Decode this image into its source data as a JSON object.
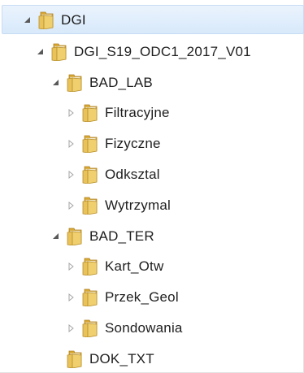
{
  "tree": {
    "nodes": [
      {
        "label": "DGI",
        "depth": 0,
        "state": "expanded",
        "selected": true,
        "icon": "folder-icon"
      },
      {
        "label": "DGI_S19_ODC1_2017_V01",
        "depth": 1,
        "state": "expanded",
        "selected": false,
        "icon": "folder-icon"
      },
      {
        "label": "BAD_LAB",
        "depth": 2,
        "state": "expanded",
        "selected": false,
        "icon": "folder-icon"
      },
      {
        "label": "Filtracyjne",
        "depth": 3,
        "state": "collapsed",
        "selected": false,
        "icon": "folder-icon"
      },
      {
        "label": "Fizyczne",
        "depth": 3,
        "state": "collapsed",
        "selected": false,
        "icon": "folder-icon"
      },
      {
        "label": "Odksztal",
        "depth": 3,
        "state": "collapsed",
        "selected": false,
        "icon": "folder-icon"
      },
      {
        "label": "Wytrzymal",
        "depth": 3,
        "state": "collapsed",
        "selected": false,
        "icon": "folder-icon"
      },
      {
        "label": "BAD_TER",
        "depth": 2,
        "state": "expanded",
        "selected": false,
        "icon": "folder-icon"
      },
      {
        "label": "Kart_Otw",
        "depth": 3,
        "state": "collapsed",
        "selected": false,
        "icon": "folder-icon"
      },
      {
        "label": "Przek_Geol",
        "depth": 3,
        "state": "collapsed",
        "selected": false,
        "icon": "folder-icon"
      },
      {
        "label": "Sondowania",
        "depth": 3,
        "state": "collapsed",
        "selected": false,
        "icon": "folder-icon"
      },
      {
        "label": "DOK_TXT",
        "depth": 2,
        "state": "leaf",
        "selected": false,
        "icon": "folder-icon"
      }
    ]
  },
  "colors": {
    "selection_bg": "#d8e9fb",
    "folder_body": "#e9c25a",
    "folder_tab": "#d9a934",
    "expander_expanded": "#595959",
    "expander_collapsed": "#a6a6a6"
  }
}
